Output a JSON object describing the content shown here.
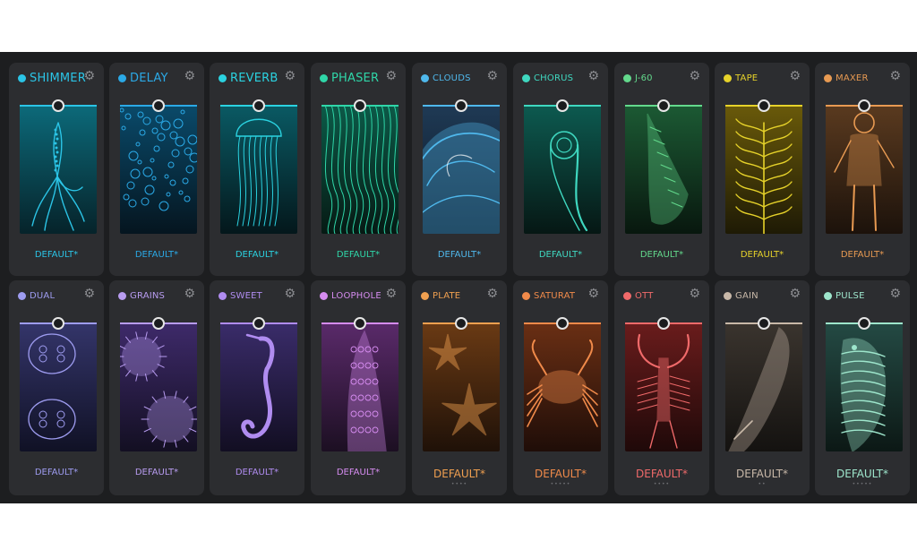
{
  "top_row": [
    {
      "id": "shimmer",
      "name": "SHIMMER",
      "color": "#2bc4e6",
      "icon": "squid-icon",
      "preset": "DEFAULT*",
      "rating": ""
    },
    {
      "id": "delay",
      "name": "DELAY",
      "color": "#2ba9e6",
      "icon": "bubbles-icon",
      "preset": "DEFAULT*",
      "rating": ""
    },
    {
      "id": "reverb",
      "name": "REVERB",
      "color": "#2bd2e0",
      "icon": "jellyfish-icon",
      "preset": "DEFAULT*",
      "rating": ""
    },
    {
      "id": "phaser",
      "name": "PHASER",
      "color": "#2fd6a8",
      "icon": "kelp-strands-icon",
      "preset": "DEFAULT*",
      "rating": ""
    },
    {
      "id": "clouds",
      "name": "CLOUDS",
      "color": "#4fb8ec",
      "icon": "wave-icon",
      "preset": "DEFAULT*",
      "rating": ""
    },
    {
      "id": "chorus",
      "name": "CHORUS",
      "color": "#3fd8c0",
      "icon": "ammonite-icon",
      "preset": "DEFAULT*",
      "rating": ""
    },
    {
      "id": "j60",
      "name": "J-60",
      "color": "#63d98c",
      "icon": "spiral-shell-icon",
      "preset": "DEFAULT*",
      "rating": ""
    },
    {
      "id": "tape",
      "name": "TAPE",
      "color": "#e6d22a",
      "icon": "seaweed-icon",
      "preset": "DEFAULT*",
      "rating": ""
    },
    {
      "id": "maxer",
      "name": "MAXER",
      "color": "#e89a52",
      "icon": "diver-icon",
      "preset": "DEFAULT*",
      "rating": ""
    }
  ],
  "bottom_row": [
    {
      "id": "dual",
      "name": "DUAL",
      "color": "#9e9cf0",
      "icon": "moon-jellyfish-icon",
      "preset": "DEFAULT*",
      "rating": ""
    },
    {
      "id": "grains",
      "name": "GRAINS",
      "color": "#b89cf0",
      "icon": "urchins-icon",
      "preset": "DEFAULT*",
      "rating": ""
    },
    {
      "id": "sweet",
      "name": "SWEET",
      "color": "#b08cf0",
      "icon": "seahorse-icon",
      "preset": "DEFAULT*",
      "rating": ""
    },
    {
      "id": "loophole",
      "name": "LOOPHOLE",
      "color": "#d68cf0",
      "icon": "moray-eel-icon",
      "preset": "DEFAULT*",
      "rating": ""
    },
    {
      "id": "plate",
      "name": "PLATE",
      "color": "#f0a050",
      "icon": "starfish-icon",
      "preset": "DEFAULT*",
      "rating": "••••"
    },
    {
      "id": "saturat",
      "name": "SATURAT",
      "color": "#f08a4a",
      "icon": "crab-icon",
      "preset": "DEFAULT*",
      "rating": "•••••"
    },
    {
      "id": "ott",
      "name": "OTT",
      "color": "#f06a6a",
      "icon": "lobster-icon",
      "preset": "DEFAULT*",
      "rating": "••••"
    },
    {
      "id": "gain",
      "name": "GAIN",
      "color": "#c8b8a8",
      "icon": "whale-icon",
      "preset": "DEFAULT*",
      "rating": "••"
    },
    {
      "id": "pulse",
      "name": "PULSE",
      "color": "#9ee6cc",
      "icon": "fish-icon",
      "preset": "DEFAULT*",
      "rating": "•••••"
    }
  ],
  "gear_icon": "gear-icon"
}
